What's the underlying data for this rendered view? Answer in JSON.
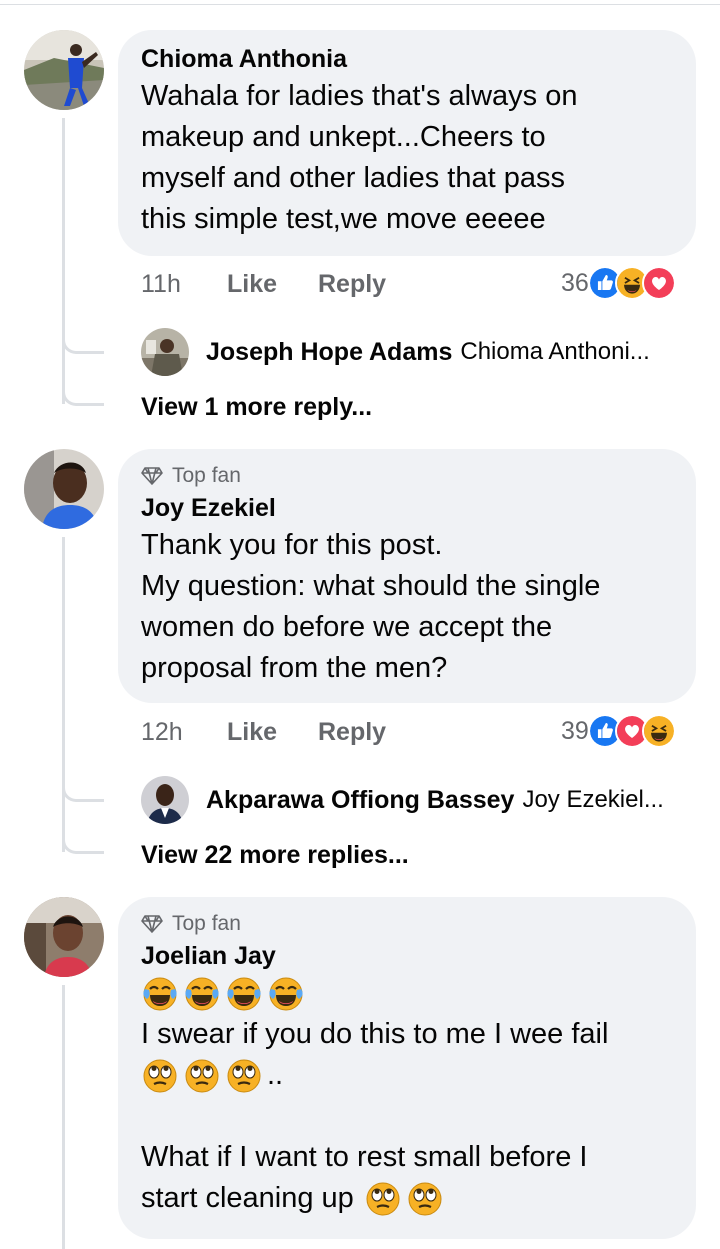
{
  "comments": [
    {
      "author": "Chioma Anthonia",
      "badge": "",
      "lines": [
        "Wahala for ladies that's always on",
        "makeup and unkept...Cheers to",
        "myself and other ladies that pass",
        "this simple test,we move eeeee"
      ],
      "time": "11h",
      "like_label": "Like",
      "reply_label": "Reply",
      "reaction_count": "36",
      "reactions": [
        "like-reaction-icon",
        "haha-reaction-icon",
        "love-reaction-icon"
      ],
      "reply_preview": {
        "name": "Joseph Hope Adams",
        "text": "Chioma Anthoni..."
      },
      "view_more": "View 1 more reply..."
    },
    {
      "author": "Joy Ezekiel",
      "badge": "Top fan",
      "lines": [
        "Thank you for this post.",
        "My question: what should the single",
        "women do before we accept the",
        "proposal from the men?"
      ],
      "time": "12h",
      "like_label": "Like",
      "reply_label": "Reply",
      "reaction_count": "39",
      "reactions": [
        "like-reaction-icon",
        "love-reaction-icon",
        "haha-reaction-icon"
      ],
      "reply_preview": {
        "name": "Akparawa Offiong Bassey",
        "text": "Joy Ezekiel..."
      },
      "view_more": "View 22 more replies..."
    },
    {
      "author": "Joelian Jay",
      "badge": "Top fan",
      "line1": "I swear if you do this to me I wee fail",
      "line2_suffix": "..",
      "line3": "What if I want to rest small before I",
      "line4": "start cleaning up",
      "emojis_row1": [
        "tears-of-joy-emoji",
        "tears-of-joy-emoji",
        "tears-of-joy-emoji",
        "tears-of-joy-emoji"
      ],
      "emojis_row2": [
        "eye-roll-emoji",
        "eye-roll-emoji",
        "eye-roll-emoji"
      ],
      "emojis_row3": [
        "eye-roll-emoji",
        "eye-roll-emoji"
      ]
    }
  ],
  "colors": {
    "bubble": "#f0f2f5",
    "meta_text": "#65676b",
    "like_blue": "#1877f2",
    "love_red": "#f33e58",
    "haha_yellow": "#f7b125",
    "thread_line": "#dcdfe3"
  }
}
